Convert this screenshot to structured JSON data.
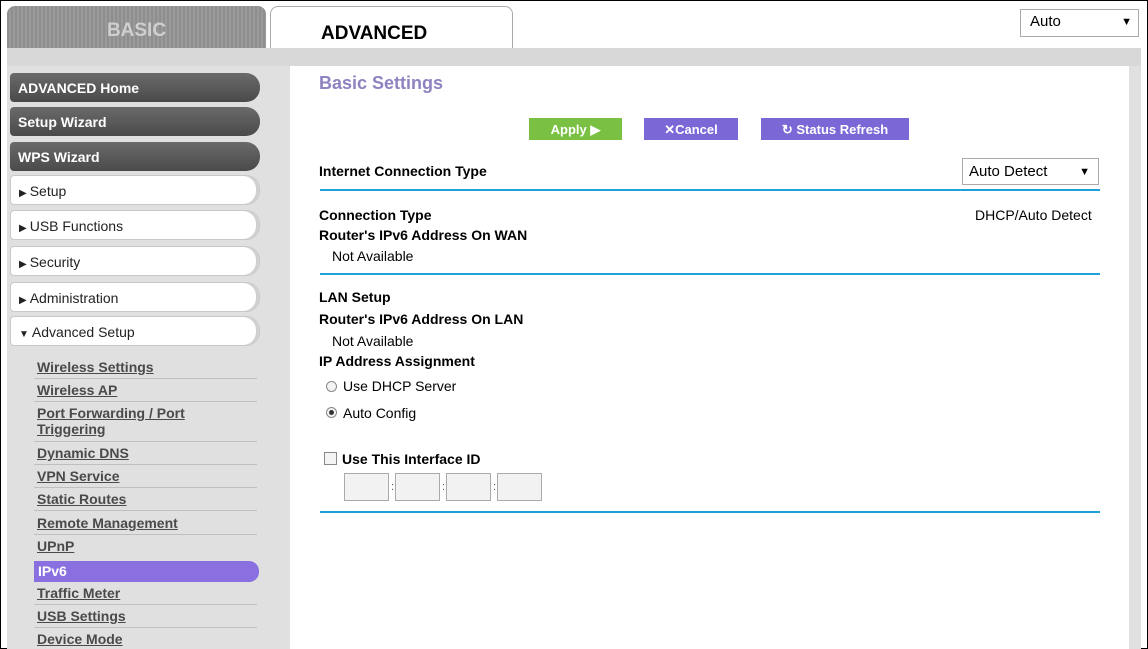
{
  "tabs": {
    "basic": "BASIC",
    "advanced": "ADVANCED"
  },
  "language_select": {
    "value": "Auto"
  },
  "sidebar": {
    "primary": [
      {
        "label": "ADVANCED Home"
      },
      {
        "label": "Setup Wizard"
      },
      {
        "label": "WPS Wizard"
      }
    ],
    "sections": [
      {
        "label": "Setup",
        "expanded": false
      },
      {
        "label": "USB Functions",
        "expanded": false
      },
      {
        "label": "Security",
        "expanded": false
      },
      {
        "label": "Administration",
        "expanded": false
      },
      {
        "label": "Advanced Setup",
        "expanded": true
      }
    ],
    "submenu": [
      "Wireless Settings",
      "Wireless AP",
      "Port Forwarding / Port Triggering",
      "Dynamic DNS",
      "VPN Service",
      "Static Routes",
      "Remote Management",
      "UPnP",
      "IPv6",
      "Traffic Meter",
      "USB Settings",
      "Device Mode"
    ],
    "active_item": "IPv6"
  },
  "page": {
    "title": "Basic Settings",
    "buttons": {
      "apply": "Apply ▶",
      "cancel": "Cancel",
      "refresh": "Status Refresh"
    },
    "internet_connection_type": {
      "label": "Internet Connection Type",
      "value": "Auto Detect"
    },
    "wan": {
      "connection_type_label": "Connection Type",
      "connection_type_value": "DHCP/Auto Detect",
      "ipv6_wan_label": "Router's IPv6 Address On WAN",
      "ipv6_wan_value": "Not Available"
    },
    "lan": {
      "heading": "LAN Setup",
      "ipv6_lan_label": "Router's IPv6 Address On LAN",
      "ipv6_lan_value": "Not Available",
      "assignment_label": "IP Address Assignment",
      "options": [
        "Use DHCP Server",
        "Auto Config"
      ],
      "selected_option": "Auto Config"
    },
    "interface_id": {
      "label": "Use This Interface ID",
      "checked": false,
      "fields": [
        "",
        "",
        "",
        ""
      ]
    }
  },
  "colors": {
    "accent_purple": "#7b68d6",
    "apply_green": "#7ac143",
    "divider_blue": "#1fa0d8",
    "title_purple": "#8f82c0"
  }
}
